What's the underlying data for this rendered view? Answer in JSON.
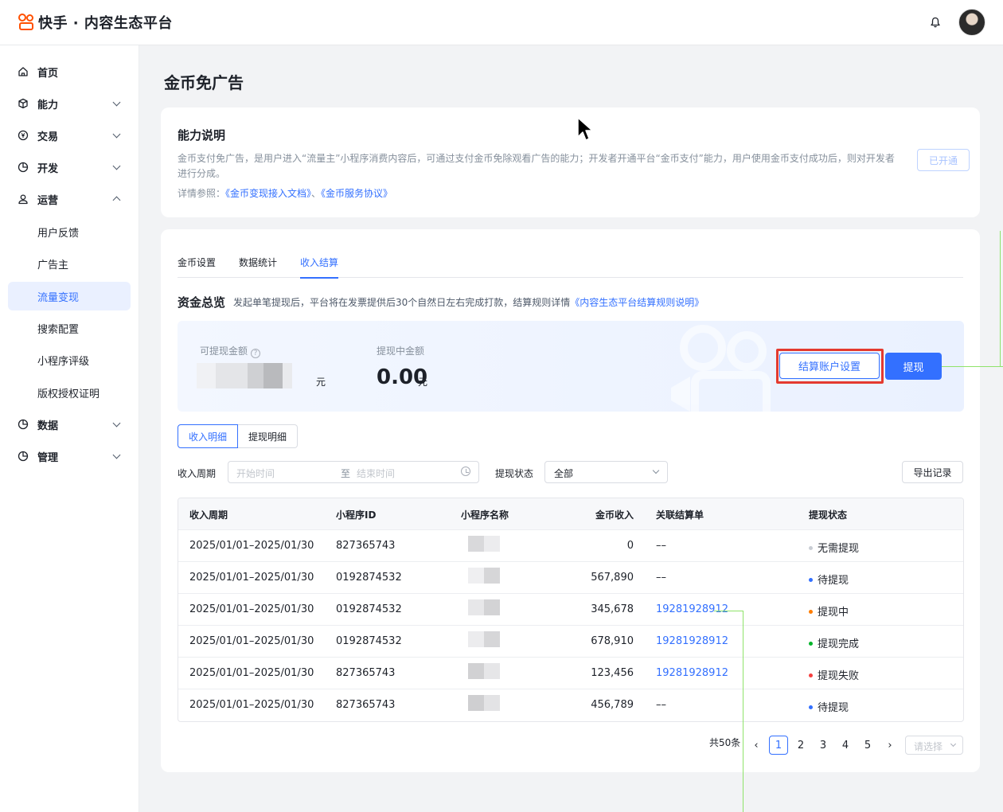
{
  "header": {
    "brand": "快手 · 内容生态平台",
    "bell_icon": "bell-icon",
    "avatar_icon": "user-avatar"
  },
  "sidebar": {
    "items": [
      {
        "label": "首页",
        "icon": "home-icon"
      },
      {
        "label": "能力",
        "icon": "cube-icon"
      },
      {
        "label": "交易",
        "icon": "yen-icon"
      },
      {
        "label": "开发",
        "icon": "pie-icon"
      },
      {
        "label": "运营",
        "icon": "user-icon"
      },
      {
        "label": "用户反馈"
      },
      {
        "label": "广告主"
      },
      {
        "label": "流量变现"
      },
      {
        "label": "搜索配置"
      },
      {
        "label": "小程序评级"
      },
      {
        "label": "版权授权证明"
      },
      {
        "label": "数据",
        "icon": "pie-icon"
      },
      {
        "label": "管理",
        "icon": "pie-icon"
      }
    ]
  },
  "page": {
    "title": "金币免广告"
  },
  "capability": {
    "title": "能力说明",
    "description": "金币支付免广告，是用户进入“流量主”小程序消费内容后，可通过支付金币免除观看广告的能力；开发者开通平台“金币支付”能力，用户使用金币支付成功后，则对开发者进行分成。",
    "ref_prefix": "详情参照：",
    "ref_link1": "《金币变现接入文档》",
    "ref_sep": "、",
    "ref_link2": "《金币服务协议》",
    "status_button": "已开通"
  },
  "tabs": [
    "金币设置",
    "数据统计",
    "收入结算"
  ],
  "funds": {
    "title": "资金总览",
    "note": "发起单笔提现后，平台将在发票提供后30个自然日左右完成打款，结算规则详情",
    "note_link": "《内容生态平台结算规则说明》",
    "withdrawable_label": "可提现金额",
    "help_icon": "question-icon",
    "withdrawable_unit": "元",
    "pending_label": "提现中金额",
    "pending_amount": "0.00",
    "pending_unit": "元",
    "settle_button": "结算账户设置",
    "withdraw_button": "提现"
  },
  "segments": [
    "收入明细",
    "提现明细"
  ],
  "filters": {
    "period_label": "收入周期",
    "start_placeholder": "开始时间",
    "to": "至",
    "end_placeholder": "结束时间",
    "status_label": "提现状态",
    "status_value": "全部",
    "export_button": "导出记录"
  },
  "table": {
    "columns": [
      "收入周期",
      "小程序ID",
      "小程序名称",
      "金币收入",
      "关联结算单",
      "提现状态"
    ],
    "rows": [
      {
        "period": "2025/01/01–2025/01/30",
        "id": "827365743",
        "coin": "0",
        "bill": "––",
        "status": "无需提现",
        "status_color": "#c9cdd4"
      },
      {
        "period": "2025/01/01–2025/01/30",
        "id": "0192874532",
        "coin": "567,890",
        "bill": "––",
        "status": "待提现",
        "status_color": "#3370ff"
      },
      {
        "period": "2025/01/01–2025/01/30",
        "id": "0192874532",
        "coin": "345,678",
        "bill": "19281928912",
        "status": "提现中",
        "status_color": "#ff7d00"
      },
      {
        "period": "2025/01/01–2025/01/30",
        "id": "0192874532",
        "coin": "678,910",
        "bill": "19281928912",
        "status": "提现完成",
        "status_color": "#00b42a"
      },
      {
        "period": "2025/01/01–2025/01/30",
        "id": "827365743",
        "coin": "123,456",
        "bill": "19281928912",
        "status": "提现失败",
        "status_color": "#f53f3f"
      },
      {
        "period": "2025/01/01–2025/01/30",
        "id": "827365743",
        "coin": "456,789",
        "bill": "––",
        "status": "待提现",
        "status_color": "#3370ff"
      }
    ]
  },
  "pagination": {
    "total": "共50条",
    "prev": "‹",
    "pages": [
      "1",
      "2",
      "3",
      "4",
      "5"
    ],
    "current": "1",
    "next": "›",
    "size_placeholder": "请选择"
  }
}
